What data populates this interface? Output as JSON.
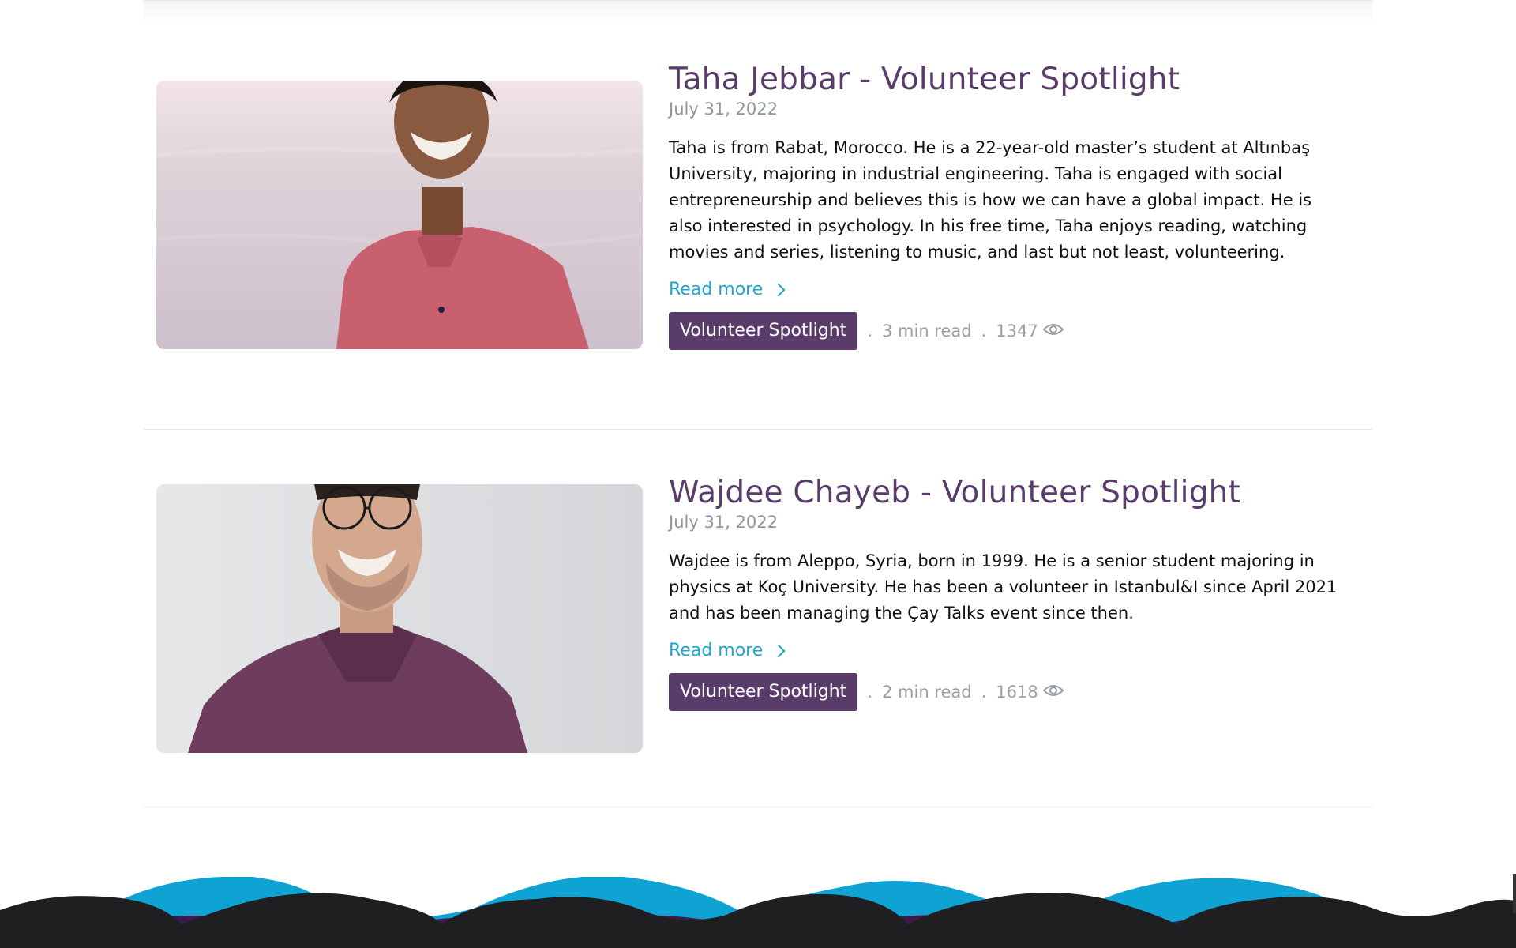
{
  "posts": [
    {
      "title": "Taha Jebbar - Volunteer Spotlight",
      "date": "July 31, 2022",
      "excerpt": "Taha is from Rabat, Morocco. He is a 22-year-old master’s student at Altınbaş University, majoring in industrial engineering. Taha is engaged with social entrepreneurship and believes this is how we can have a global impact. He is also interested in psychology. In his free time, Taha enjoys reading, watching movies and series, listening to music, and last but not least, volunteering.",
      "read_more": "Read more",
      "category": "Volunteer Spotlight",
      "read_time": "3 min read",
      "views": "1347"
    },
    {
      "title": "Wajdee Chayeb - Volunteer Spotlight",
      "date": "July 31, 2022",
      "excerpt": "Wajdee is from Aleppo, Syria, born in 1999. He is a senior student majoring in physics at Koç University. He has been a volunteer in Istanbul&I since April 2021 and has been managing the Çay Talks event since then.",
      "read_more": "Read more",
      "category": "Volunteer Spotlight",
      "read_time": "2 min read",
      "views": "1618"
    }
  ],
  "separator": ".",
  "icons": {
    "views": "eye-icon",
    "read_more": "chevron-right-icon"
  },
  "colors": {
    "title": "#5a3c6a",
    "tag_bg": "#5a3c6a",
    "link": "#1fa3cf",
    "meta": "#9aa0a6",
    "wave_blue": "#0fa3d3",
    "wave_purple": "#3d1a4b",
    "wave_dark": "#1f1f22"
  }
}
